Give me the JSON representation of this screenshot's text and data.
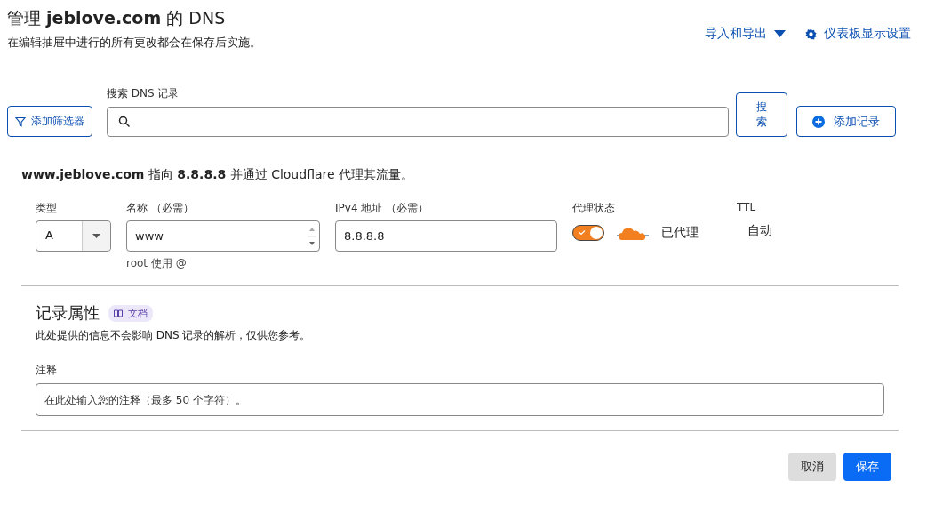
{
  "header": {
    "title": "管理 **jeblove.com** 的 DNS",
    "subtitle": "在编辑抽屉中进行的所有更改都会在保存后实施。",
    "links": [
      {
        "label": "导入和导出",
        "kind": "dropdown"
      },
      {
        "label": "仪表板显示设置",
        "kind": "settings"
      }
    ]
  },
  "toolbar": {
    "filter_button": "添加筛选器",
    "search_label": "搜索 DNS 记录",
    "search_button": "搜索",
    "add_button": "添加记录"
  },
  "summary": "**www.jeblove.com** 指向 **8.8.8.8** 并通过 Cloudflare 代理其流量。",
  "form": {
    "type": {
      "label": "类型",
      "value": "A"
    },
    "name": {
      "label": "名称 （必需）",
      "value": "www",
      "hint": "root 使用 @"
    },
    "ipv4": {
      "label": "IPv4 地址 （必需）",
      "value": "8.8.8.8"
    },
    "proxy": {
      "label": "代理状态",
      "on": true,
      "status": "已代理"
    },
    "ttl": {
      "label": "TTL",
      "value": "自动"
    }
  },
  "attributes": {
    "title": "记录属性",
    "docs_tag": "文档",
    "description": "此处提供的信息不会影响 DNS 记录的解析，仅供您参考。",
    "comment_label": "注释",
    "comment_placeholder": "在此处输入您的注释（最多 50 个字符）。"
  },
  "buttons": [
    {
      "label": "取消",
      "kind": "secondary"
    },
    {
      "label": "保存",
      "kind": "primary"
    }
  ]
}
